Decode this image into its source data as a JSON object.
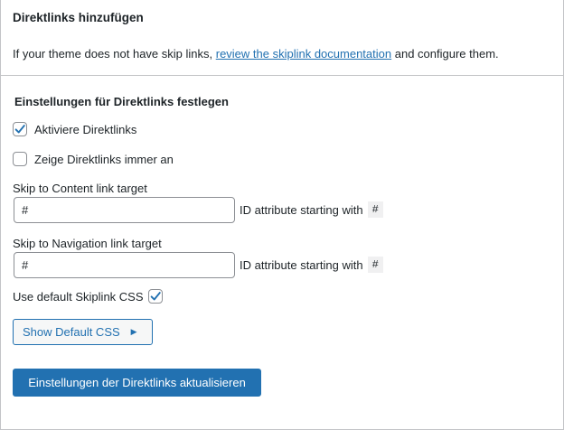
{
  "panel": {
    "title": "Direktlinks hinzufügen",
    "description_prefix": "If your theme does not have skip links, ",
    "description_link": "review the skiplink documentation",
    "description_suffix": " and configure them."
  },
  "settings": {
    "section_title": "Einstellungen für Direktlinks festlegen",
    "enable_label": "Aktiviere Direktlinks",
    "enable_checked": true,
    "always_show_label": "Zeige Direktlinks immer an",
    "always_show_checked": false,
    "content_target": {
      "label": "Skip to Content link target",
      "value": "#",
      "hint": "ID attribute starting with",
      "hint_code": "#"
    },
    "navigation_target": {
      "label": "Skip to Navigation link target",
      "value": "#",
      "hint": "ID attribute starting with",
      "hint_code": "#"
    },
    "default_css_label": "Use default Skiplink CSS",
    "default_css_checked": true,
    "show_css_button": "Show Default CSS",
    "show_css_arrow": "▶",
    "submit_button": "Einstellungen der Direktlinks aktualisieren"
  },
  "colors": {
    "accent": "#2271b1",
    "border": "#c3c4c7",
    "text": "#1d2327"
  }
}
